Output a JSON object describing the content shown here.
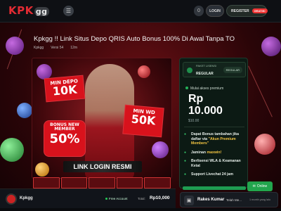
{
  "header": {
    "logo_main": "KPK",
    "logo_suffix": "gg",
    "menu_icon": "hamburger-icon",
    "balance_button": "0",
    "login_label": "LOGIN",
    "register_label": "REGISTER",
    "register_badge": "GRATIS!"
  },
  "page": {
    "title": "Kpkgg !! Link Situs Depo QRIS Auto Bonus 100% Di Awal Tanpa TO",
    "meta": [
      "Kpkgg",
      "Versi 54",
      "12m"
    ]
  },
  "banner": {
    "min_depo_small": "MIN DEPO",
    "min_depo_big": "10K",
    "min_wd_small": "MIN WD",
    "min_wd_big": "50K",
    "bonus_small": "BONUS NEW MEMBER",
    "bonus_big": "50%",
    "link_login": "LINK LOGIN RESMI"
  },
  "panel": {
    "package_small": "PAKET LISENSI",
    "package_name": "REGULAR",
    "package_badge": "REGULAR",
    "price_label": "Mulai akses premium",
    "price_currency": "Rp",
    "price_amount": "10.000",
    "price_sub": "$10.00",
    "features": [
      {
        "text": "Dapat Bonus tambahan jika daftar via",
        "highlight": "\"Akun Premium Members\""
      },
      {
        "text": "Jaminan",
        "highlight": "maxwin!"
      },
      {
        "text": "Berlisensi WLA & Keamanan Ketat",
        "highlight": ""
      },
      {
        "text": "Support Livechat 24 jam",
        "highlight": ""
      }
    ]
  },
  "online_button": "Online",
  "footer": {
    "name": "Kpkgg",
    "free_account": "Free Account",
    "total_label": "Total:",
    "total_value": "Rp10,000"
  },
  "toast": {
    "name": "Rakes Kumar",
    "text": "Telah Me...",
    "time": "1 month yang lalu"
  },
  "colors": {
    "brand_red": "#e22b33",
    "accent_green": "#22a54d",
    "panel_bg": "#0c1a14"
  }
}
